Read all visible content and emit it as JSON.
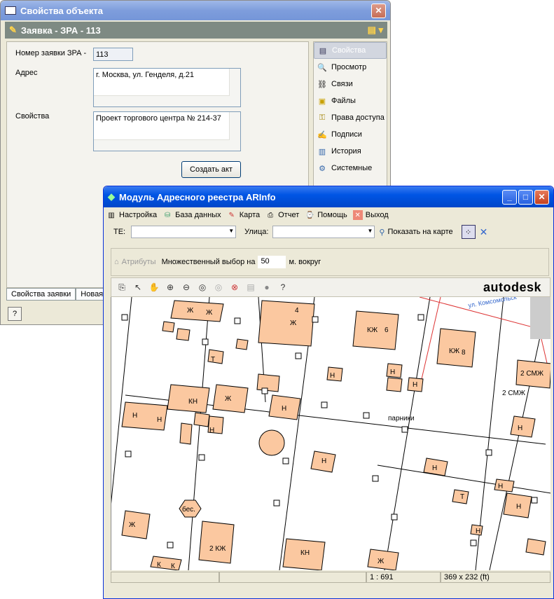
{
  "win1": {
    "title": "Свойства объекта",
    "object_title": "Заявка - ЗРА - 113",
    "fields": {
      "number_label": "Номер заявки  ЗРА -",
      "number_value": "113",
      "address_label": "Адрес",
      "address_value": "г. Москва, ул. Генделя, д.21",
      "props_label": "Свойства",
      "props_value": "Проект торгового центра № 214-37"
    },
    "create_btn": "Создать акт",
    "side": [
      "Свойства",
      "Просмотр",
      "Связи",
      "Файлы",
      "Права доступа",
      "Подписи",
      "История",
      "Системные"
    ],
    "tabs": [
      "Свойства заявки",
      "Новая"
    ]
  },
  "win2": {
    "title": "Модуль Адресного реестра ARInfo",
    "menu": [
      "Настройка",
      "База данных",
      "Карта",
      "Отчет",
      "Помощь",
      "Выход"
    ],
    "te_label": "ТЕ:",
    "street_label": "Улица:",
    "show_on_map": "Показать на карте",
    "attrs": "Атрибуты",
    "multi_label": "Множественный выбор на",
    "multi_value": "50",
    "multi_unit": "м. вокруг",
    "brand": "autodesk",
    "status": [
      "",
      "1 : 691",
      "369 x 232 (ft)"
    ],
    "map_labels": [
      "Ж",
      "Ж",
      "Ж",
      "4",
      "Ж",
      "Ж",
      "КЖ",
      "6",
      "КЖ",
      "8",
      "2 СМЖ",
      "2 СМЖ",
      "Т",
      "Н",
      "Н",
      "Н",
      "КН",
      "Ж",
      "Н",
      "Н",
      "Н",
      "Н",
      "Н",
      "Н",
      "Н",
      "Н",
      "Н",
      "Т",
      "Н",
      "Н",
      "Н",
      "Ж",
      "2 КЖ",
      "КН",
      "Ж",
      "К",
      "К",
      "бес.",
      "парники",
      "ул. Комсомольск"
    ]
  },
  "colors": {
    "building": "#fbc8a0",
    "title_active": "#0055e5",
    "title_inactive": "#7e9ddc"
  }
}
